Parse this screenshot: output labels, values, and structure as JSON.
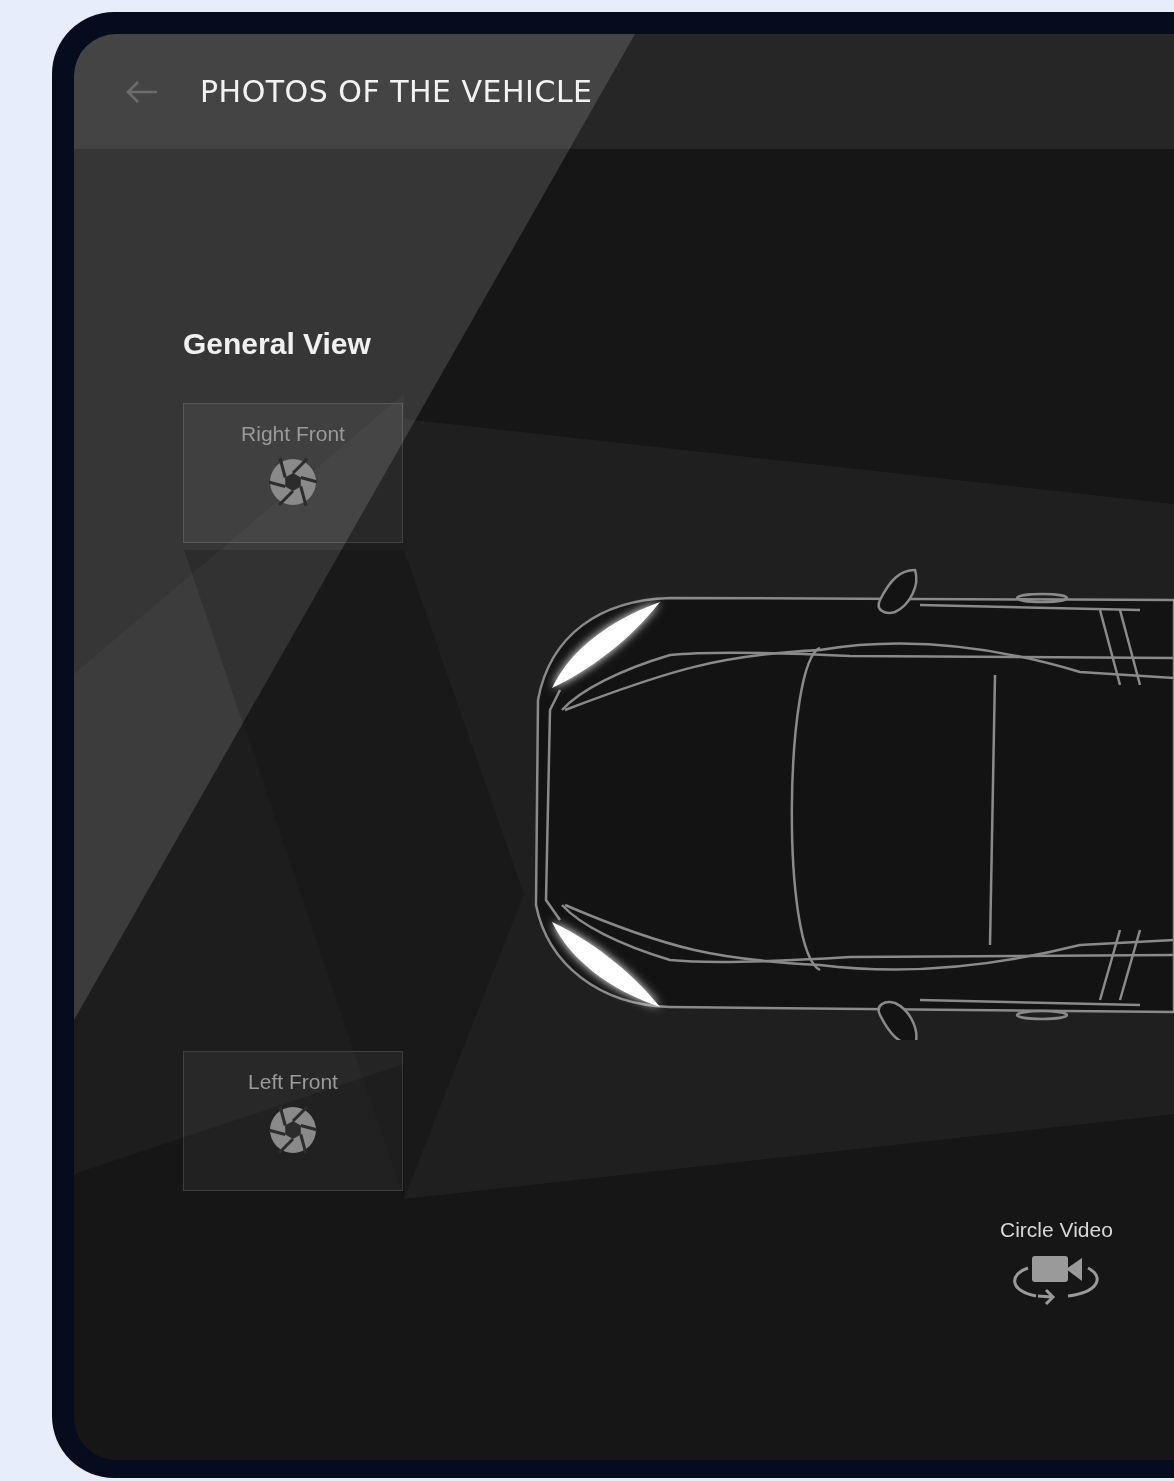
{
  "header": {
    "title": "PHOTOS OF THE VEHICLE"
  },
  "section": {
    "title": "General View"
  },
  "shots": [
    {
      "label": "Right Front"
    },
    {
      "label": "Left Front"
    }
  ],
  "video": {
    "label": "Circle Video"
  }
}
